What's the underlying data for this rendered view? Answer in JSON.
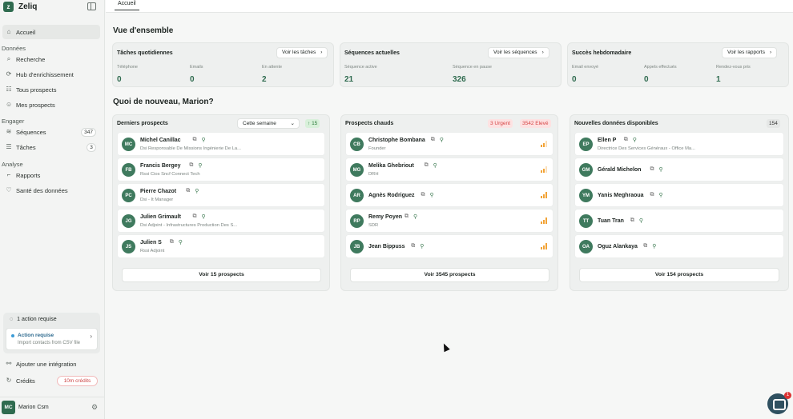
{
  "app": {
    "name": "Zeliq"
  },
  "sidebar": {
    "home": "Accueil",
    "sections": {
      "data": "Données",
      "engage": "Engager",
      "analysis": "Analyse"
    },
    "items": {
      "search": "Recherche",
      "hub": "Hub d'enrichissement",
      "all_prospects": "Tous prospects",
      "my_prospects": "Mes prospects",
      "sequences": "Séquences",
      "sequences_count": "347",
      "tasks": "Tâches",
      "tasks_count": "3",
      "reports": "Rapports",
      "data_health": "Santé des données"
    },
    "action_box": {
      "header": "1 action requise",
      "title": "Action requise",
      "subtitle": "Import contacts from CSV file"
    },
    "add_integration": "Ajouter une intégration",
    "credits_label": "Crédits",
    "credits_badge": "10m crédits",
    "user": {
      "initials": "MC",
      "name": "Marion Csm"
    }
  },
  "topbar": {
    "tab": "Accueil"
  },
  "overview": {
    "title": "Vue d'ensemble",
    "daily": {
      "title": "Tâches quotidiennes",
      "button": "Voir les tâches",
      "labels": [
        "Téléphone",
        "Emails",
        "En attente"
      ],
      "values": [
        "0",
        "0",
        "2"
      ]
    },
    "current": {
      "title": "Séquences actuelles",
      "button": "Voir les séquences",
      "labels": [
        "Séquence active",
        "Séquence en pause"
      ],
      "values": [
        "21",
        "326"
      ]
    },
    "weekly": {
      "title": "Succès hebdomadaire",
      "button": "Voir les rapports",
      "labels": [
        "Email envoyé",
        "Appels effectués",
        "Rendez-vous pris"
      ],
      "values": [
        "0",
        "0",
        "1"
      ]
    }
  },
  "news": {
    "title": "Quoi de nouveau, Marion?",
    "latest": {
      "title": "Derniers prospects",
      "filter": "Cette semaine",
      "badge": "15",
      "rows": [
        {
          "initials": "MC",
          "name": "Michel Canillac",
          "sub": "Dsi Responsable De Missions Ingénierie De La..."
        },
        {
          "initials": "FB",
          "name": "Francis Bergey",
          "sub": "Rssi Cios Sncf Connect Tech"
        },
        {
          "initials": "PC",
          "name": "Pierre Chazot",
          "sub": "Dsi - It Manager"
        },
        {
          "initials": "JG",
          "name": "Julien Grimault",
          "sub": "Dsi Adjoint - Infrastructures Production Des S..."
        },
        {
          "initials": "JS",
          "name": "Julien S",
          "sub": "Rssi Adjoint"
        }
      ],
      "button": "Voir 15 prospects"
    },
    "hot": {
      "title": "Prospects chauds",
      "urgent": "3 Urgent",
      "high": "3542 Elevé",
      "rows": [
        {
          "initials": "CB",
          "name": "Christophe Bombana",
          "sub": "Founder"
        },
        {
          "initials": "MG",
          "name": "Melika Ghebriout",
          "sub": "DRH"
        },
        {
          "initials": "AR",
          "name": "Agnès Rodriguez",
          "sub": ""
        },
        {
          "initials": "RP",
          "name": "Remy Poyen",
          "sub": "SDR"
        },
        {
          "initials": "JB",
          "name": "Jean Bippuss",
          "sub": ""
        }
      ],
      "button": "Voir 3545 prospects"
    },
    "new_data": {
      "title": "Nouvelles données disponibles",
      "badge": "154",
      "rows": [
        {
          "initials": "EP",
          "name": "Ellen P",
          "sub": "Directrice Des Services Généraux - Office Ma..."
        },
        {
          "initials": "GM",
          "name": "Gérald Michelon",
          "sub": ""
        },
        {
          "initials": "YM",
          "name": "Yanis Meghraoua",
          "sub": ""
        },
        {
          "initials": "TT",
          "name": "Tuan Tran",
          "sub": ""
        },
        {
          "initials": "OA",
          "name": "Oguz Alankaya",
          "sub": ""
        }
      ],
      "button": "Voir 154 prospects"
    }
  },
  "chat_badge": "1",
  "colors": {
    "brand": "#2f6b4f",
    "urgent": "#d64545",
    "heat": "#f2a336"
  }
}
